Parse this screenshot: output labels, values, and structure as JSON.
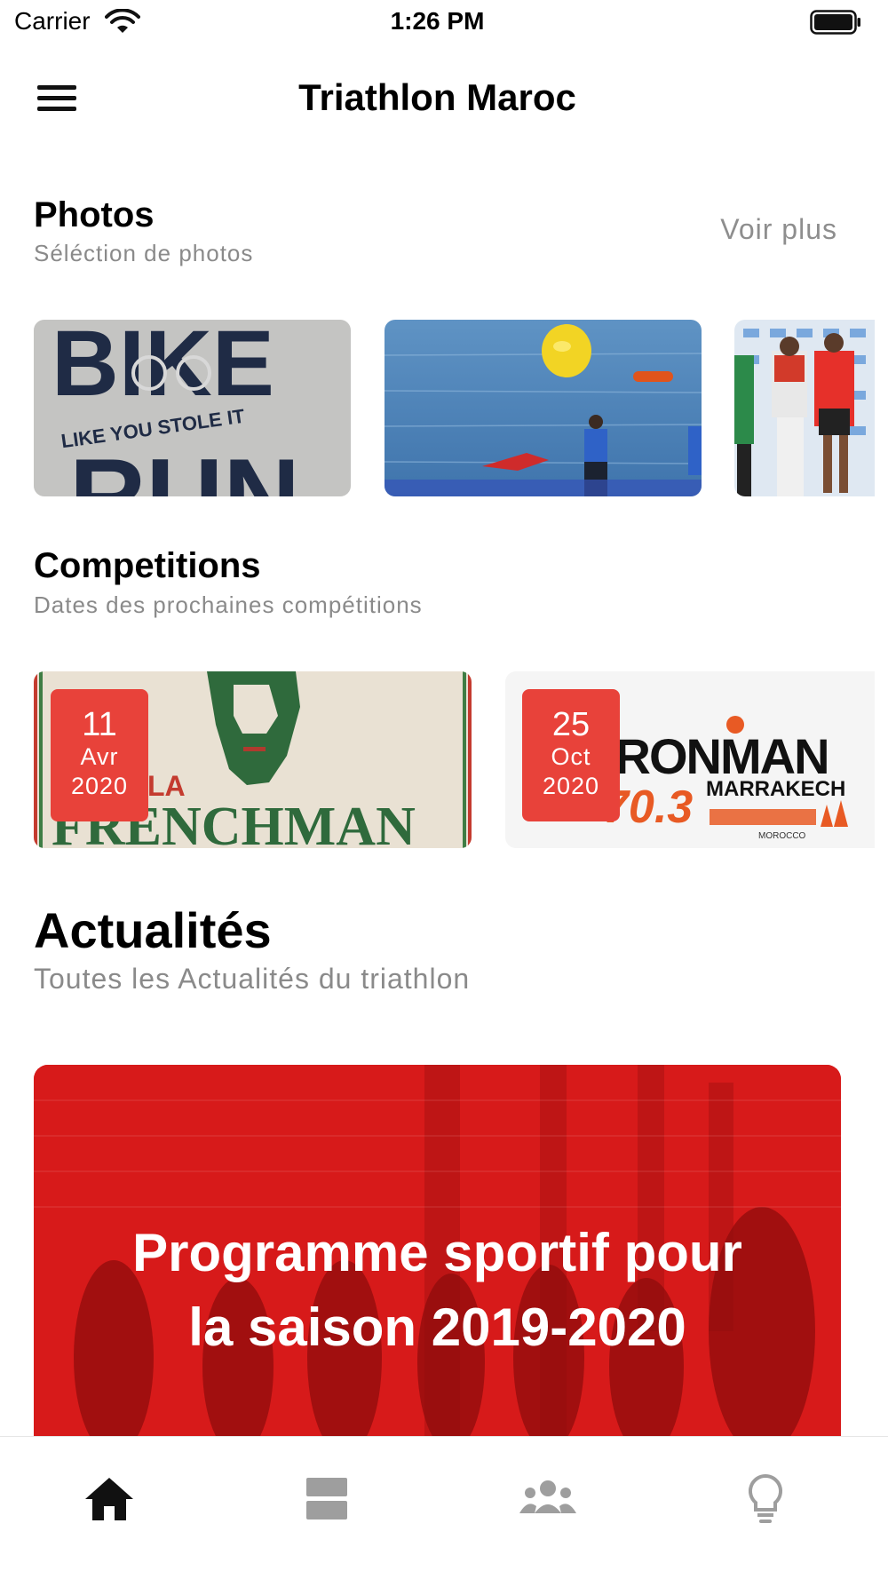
{
  "status_bar": {
    "carrier": "Carrier",
    "time": "1:26 PM"
  },
  "header": {
    "title": "Triathlon Maroc",
    "menu_icon": "hamburger-menu-icon"
  },
  "photos": {
    "title": "Photos",
    "subtitle": "Séléction de photos",
    "more_label": "Voir plus",
    "items": [
      {
        "image_text_1": "BIKE",
        "image_text_2": "LIKE YOU STOLE IT",
        "image_text_3": "RUN"
      },
      {
        "image_text_1": ""
      },
      {
        "image_text_1": ""
      }
    ]
  },
  "competitions": {
    "title": "Competitions",
    "subtitle": "Dates des prochaines compétitions",
    "items": [
      {
        "day": "11",
        "month": "Avr",
        "year": "2020",
        "logo_text": "FRENCHMAN",
        "logo_prefix": "LA"
      },
      {
        "day": "25",
        "month": "Oct",
        "year": "2020",
        "logo_text": "IRONMAN",
        "logo_sub": "70.3",
        "logo_city": "MARRAKECH",
        "logo_country": "MOROCCO"
      }
    ]
  },
  "news": {
    "title": "Actualités",
    "subtitle": "Toutes les Actualités du triathlon",
    "headline_line1": "Programme sportif pour",
    "headline_line2": "la saison 2019-2020"
  },
  "tab_bar": {
    "tabs": [
      {
        "icon": "home-icon",
        "active": true
      },
      {
        "icon": "list-icon",
        "active": false
      },
      {
        "icon": "people-icon",
        "active": false
      },
      {
        "icon": "lightbulb-icon",
        "active": false
      }
    ]
  },
  "colors": {
    "accent_red": "#e8423a",
    "active_tab": "#111111",
    "inactive_tab": "#9e9e9e"
  }
}
